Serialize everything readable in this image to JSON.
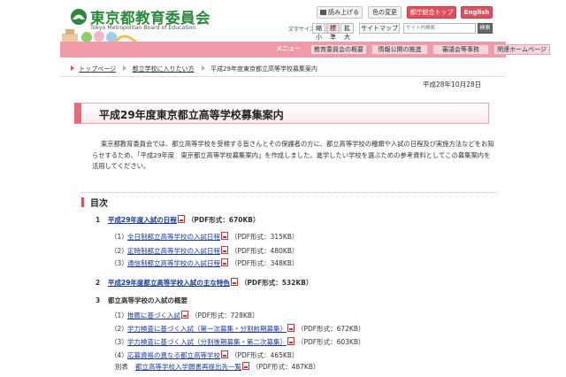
{
  "header": {
    "logo_title": "東京都教育委員会",
    "logo_subtitle": "Tokyo Metropolitan Board of Education",
    "speak_button": "読み上げる",
    "color_button": "色の変更",
    "gov_button": "都庁総合トップ",
    "english_button": "English",
    "font_size_label": "文字サイズ",
    "font_small": "縮小",
    "font_standard": "標準",
    "font_large": "拡大",
    "sitemap_button": "サイトマップ",
    "search_placeholder": "サイト内検索",
    "search_button": "検索"
  },
  "nav": {
    "menu_label": "メニュー",
    "items": [
      "教育委員会の概要",
      "情報公開の推進",
      "審議会等事務",
      "関連ホームページ"
    ]
  },
  "breadcrumb": {
    "items": [
      "トップページ",
      "都立学校に入りたい方",
      "平成29年度東京都立高等学校募集案内"
    ]
  },
  "date": "平成28年10月28日",
  "page_title": "平成29年度東京都立高等学校募集案内",
  "intro": "東京都教育委員会では、都立高等学校を受検する皆さんとその保護者の方に、都立高等学校の種類や入試の日程及び実施方法などをお知らせするため、「平成29年度　東京都立高等学校募集案内」を作成しました。進学したい学校を選ぶための参考資料としてこの募集案内を活用してください。",
  "toc": {
    "title": "目次",
    "sections": [
      {
        "num": "1",
        "label": "平成29年度入試の日程",
        "size": "（PDF形式：670KB）",
        "items": [
          {
            "paren": "（1）",
            "label": "全日制都立高等学校の入試日程",
            "size": "（PDF形式：315KB）"
          },
          {
            "paren": "（2）",
            "label": "定時制都立高等学校の入試日程",
            "size": "（PDF形式：480KB）"
          },
          {
            "paren": "（3）",
            "label": "通信制都立高等学校の入試日程",
            "size": "（PDF形式：348KB）"
          }
        ]
      },
      {
        "num": "2",
        "label": "平成29年度都立高等学校入試の主な特色",
        "size": "（PDF形式：532KB）"
      },
      {
        "num": "3",
        "label": "都立高等学校の入試の概要",
        "items": [
          {
            "paren": "（1）",
            "label": "推薦に基づく入試",
            "size": "（PDF形式：728KB）"
          },
          {
            "paren": "（2）",
            "label": "学力検査に基づく入試（第一次募集・分割前期募集）",
            "size": "（PDF形式：672KB）"
          },
          {
            "paren": "（3）",
            "label": "学力検査に基づく入試（分割後期募集・第二次募集）",
            "size": "（PDF形式：603KB）"
          },
          {
            "paren": "（4）",
            "label": "応募資格の異なる都立高等学校",
            "size": "（PDF形式：465KB）"
          }
        ],
        "appendix": {
          "prefix": "別表",
          "label": "都立高等学校入学願書再提出先一覧",
          "size": "（PDF形式：487KB）"
        }
      }
    ]
  },
  "colors": {
    "accent": "#e24f5c",
    "nav_pink": "#f19aa5",
    "logo_green": "#2a8a3a",
    "link": "#1a3a9c"
  }
}
